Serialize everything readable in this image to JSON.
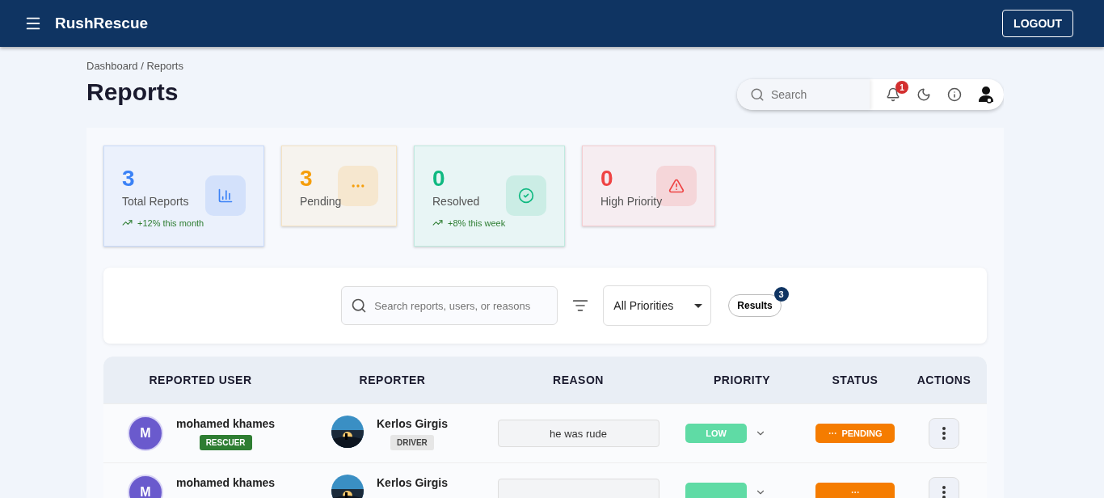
{
  "app_bar": {
    "brand": "RushRescue",
    "logout": "LOGOUT"
  },
  "breadcrumb": "Dashboard / Reports",
  "title": "Reports",
  "toolbar": {
    "search_placeholder": "Search",
    "notification_count": "1"
  },
  "stats": [
    {
      "kind": "total",
      "value": "3",
      "label": "Total Reports",
      "trend": "+12% this month",
      "color": "#3b82f6"
    },
    {
      "kind": "pending",
      "value": "3",
      "label": "Pending",
      "color": "#f59e0b"
    },
    {
      "kind": "resolved",
      "value": "0",
      "label": "Resolved",
      "trend": "+8% this week",
      "color": "#10b981"
    },
    {
      "kind": "high",
      "value": "0",
      "label": "High Priority",
      "color": "#ef4444"
    }
  ],
  "filters": {
    "search_placeholder": "Search reports, users, or reasons",
    "priority": "All Priorities",
    "results_label": "Results",
    "results_count": "3"
  },
  "table": {
    "columns": [
      "REPORTED USER",
      "REPORTER",
      "REASON",
      "PRIORITY",
      "STATUS",
      "ACTIONS"
    ],
    "rows": [
      {
        "user": "mohamed khames",
        "user_initial": "M",
        "user_role": "RESCUER",
        "reporter": "Kerlos Girgis",
        "reporter_role": "DRIVER",
        "reason": "he was rude",
        "priority": "LOW",
        "status": "PENDING"
      },
      {
        "user": "mohamed khames",
        "user_initial": "M",
        "reporter": "Kerlos Girgis"
      }
    ]
  }
}
